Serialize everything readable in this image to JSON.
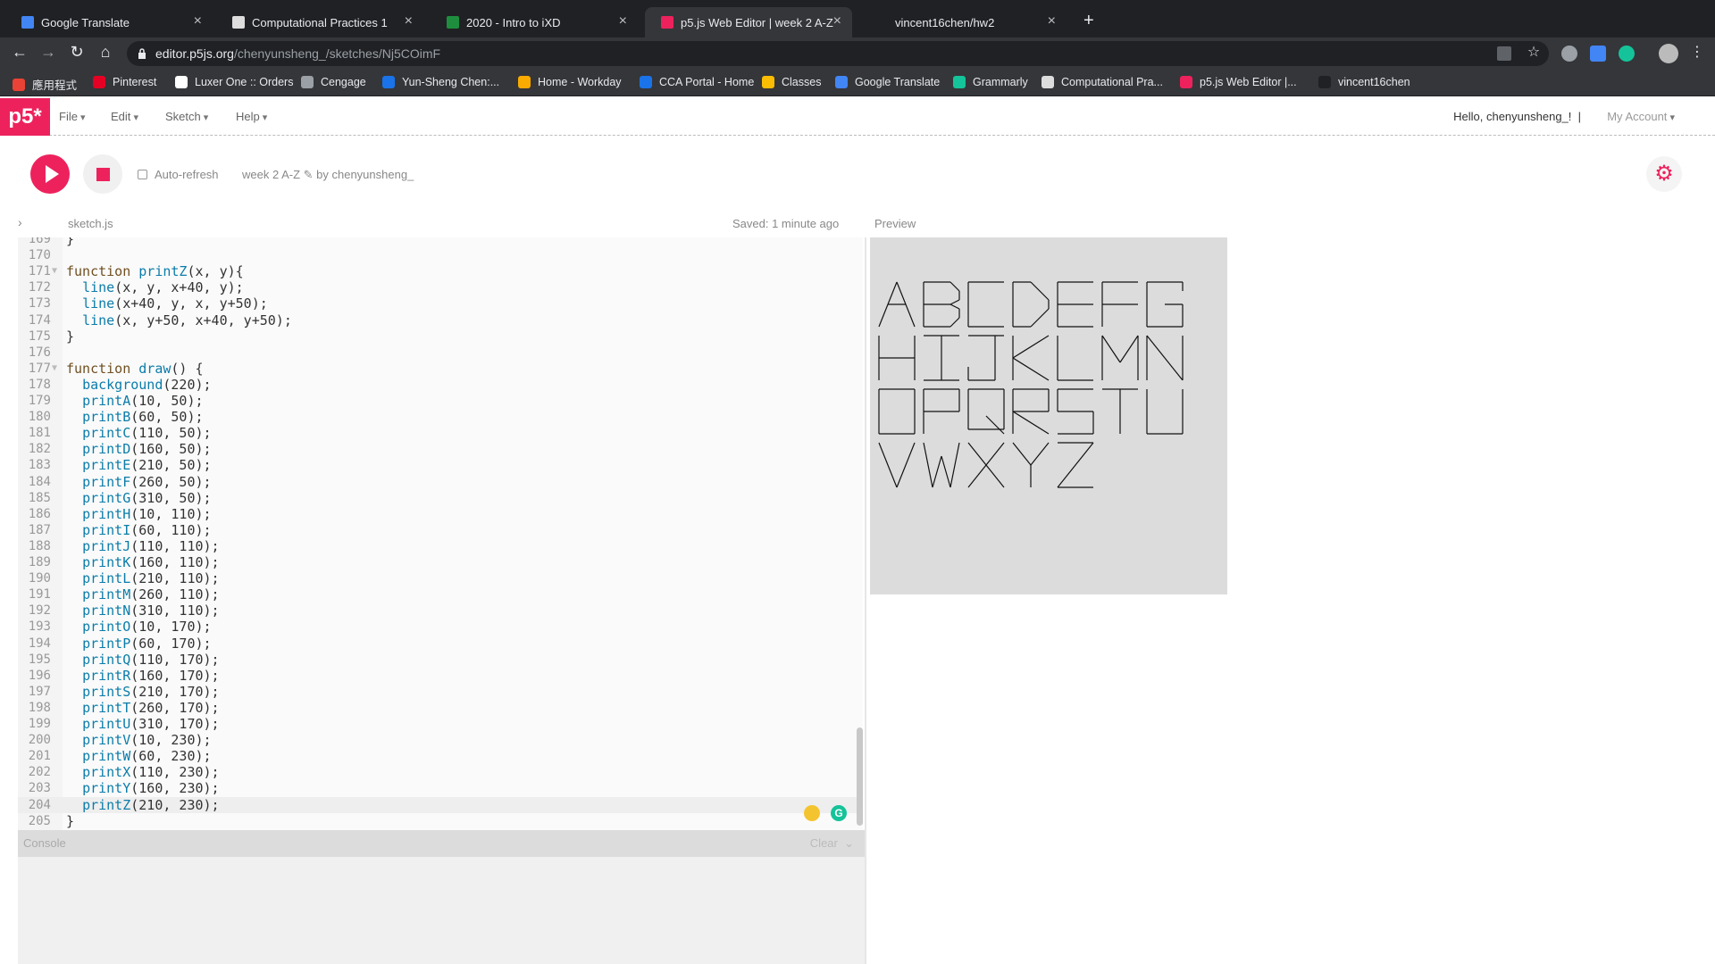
{
  "browser": {
    "tabs": [
      {
        "title": "Google Translate",
        "favicon_color": "#4285f4",
        "active": false
      },
      {
        "title": "Computational Practices 1",
        "favicon_color": "#dddddd",
        "active": false
      },
      {
        "title": "2020 - Intro to iXD",
        "favicon_color": "#1e8e3e",
        "active": false
      },
      {
        "title": "p5.js Web Editor | week 2 A-Z",
        "favicon_color": "#ed225d",
        "active": true
      },
      {
        "title": "vincent16chen/hw2",
        "favicon_color": "#202124",
        "active": false
      }
    ],
    "new_tab": "+",
    "url_host": "editor.p5js.org",
    "url_path": "/chenyunsheng_/sketches/Nj5COimF",
    "bookmarks": [
      {
        "label": "應用程式",
        "color": "#ea4335"
      },
      {
        "label": "Pinterest",
        "color": "#e60023"
      },
      {
        "label": "Luxer One :: Orders",
        "color": "#ffffff"
      },
      {
        "label": "Cengage",
        "color": "#9aa0a6"
      },
      {
        "label": "Yun-Sheng Chen:...",
        "color": "#1a73e8"
      },
      {
        "label": "Home - Workday",
        "color": "#f9ab00"
      },
      {
        "label": "CCA Portal - Home",
        "color": "#1a73e8"
      },
      {
        "label": "Classes",
        "color": "#fbbc04"
      },
      {
        "label": "Google Translate",
        "color": "#4285f4"
      },
      {
        "label": "Grammarly",
        "color": "#15c39a"
      },
      {
        "label": "Computational Pra...",
        "color": "#dddddd"
      },
      {
        "label": "p5.js Web Editor |...",
        "color": "#ed225d"
      },
      {
        "label": "vincent16chen",
        "color": "#202124"
      }
    ]
  },
  "p5": {
    "logo": "p5*",
    "menu": [
      "File",
      "Edit",
      "Sketch",
      "Help"
    ],
    "greeting": "Hello, chenyunsheng_!",
    "account": "My Account",
    "auto_refresh": "Auto-refresh",
    "sketch_name": "week 2 A-Z ✎ by chenyunsheng_",
    "file_name": "sketch.js",
    "saved": "Saved: 1 minute ago",
    "preview_label": "Preview",
    "console_label": "Console",
    "console_clear": "Clear",
    "accent": "#ed225d"
  },
  "code": [
    {
      "n": "169",
      "t": "}",
      "fold": false
    },
    {
      "n": "170",
      "t": "",
      "fold": false
    },
    {
      "n": "171",
      "t": "function printZ(x, y){",
      "fold": true
    },
    {
      "n": "172",
      "t": "  line(x, y, x+40, y);",
      "fold": false
    },
    {
      "n": "173",
      "t": "  line(x+40, y, x, y+50);",
      "fold": false
    },
    {
      "n": "174",
      "t": "  line(x, y+50, x+40, y+50);",
      "fold": false
    },
    {
      "n": "175",
      "t": "}",
      "fold": false
    },
    {
      "n": "176",
      "t": "",
      "fold": false
    },
    {
      "n": "177",
      "t": "function draw() {",
      "fold": true
    },
    {
      "n": "178",
      "t": "  background(220);",
      "fold": false
    },
    {
      "n": "179",
      "t": "  printA(10, 50);",
      "fold": false
    },
    {
      "n": "180",
      "t": "  printB(60, 50);",
      "fold": false
    },
    {
      "n": "181",
      "t": "  printC(110, 50);",
      "fold": false
    },
    {
      "n": "182",
      "t": "  printD(160, 50);",
      "fold": false
    },
    {
      "n": "183",
      "t": "  printE(210, 50);",
      "fold": false
    },
    {
      "n": "184",
      "t": "  printF(260, 50);",
      "fold": false
    },
    {
      "n": "185",
      "t": "  printG(310, 50);",
      "fold": false
    },
    {
      "n": "186",
      "t": "  printH(10, 110);",
      "fold": false
    },
    {
      "n": "187",
      "t": "  printI(60, 110);",
      "fold": false
    },
    {
      "n": "188",
      "t": "  printJ(110, 110);",
      "fold": false
    },
    {
      "n": "189",
      "t": "  printK(160, 110);",
      "fold": false
    },
    {
      "n": "190",
      "t": "  printL(210, 110);",
      "fold": false
    },
    {
      "n": "191",
      "t": "  printM(260, 110);",
      "fold": false
    },
    {
      "n": "192",
      "t": "  printN(310, 110);",
      "fold": false
    },
    {
      "n": "193",
      "t": "  printO(10, 170);",
      "fold": false
    },
    {
      "n": "194",
      "t": "  printP(60, 170);",
      "fold": false
    },
    {
      "n": "195",
      "t": "  printQ(110, 170);",
      "fold": false
    },
    {
      "n": "196",
      "t": "  printR(160, 170);",
      "fold": false
    },
    {
      "n": "197",
      "t": "  printS(210, 170);",
      "fold": false
    },
    {
      "n": "198",
      "t": "  printT(260, 170);",
      "fold": false
    },
    {
      "n": "199",
      "t": "  printU(310, 170);",
      "fold": false
    },
    {
      "n": "200",
      "t": "  printV(10, 230);",
      "fold": false
    },
    {
      "n": "201",
      "t": "  printW(60, 230);",
      "fold": false
    },
    {
      "n": "202",
      "t": "  printX(110, 230);",
      "fold": false
    },
    {
      "n": "203",
      "t": "  printY(160, 230);",
      "fold": false
    },
    {
      "n": "204",
      "t": "  printZ(210, 230);",
      "fold": false
    },
    {
      "n": "205",
      "t": "}",
      "fold": false
    }
  ],
  "current_line": "204",
  "preview": {
    "background": "#dcdcdc",
    "rows": [
      "ABCDEFG",
      "HIJKLMN",
      "OPQRSTU",
      "VWXYZ"
    ]
  }
}
